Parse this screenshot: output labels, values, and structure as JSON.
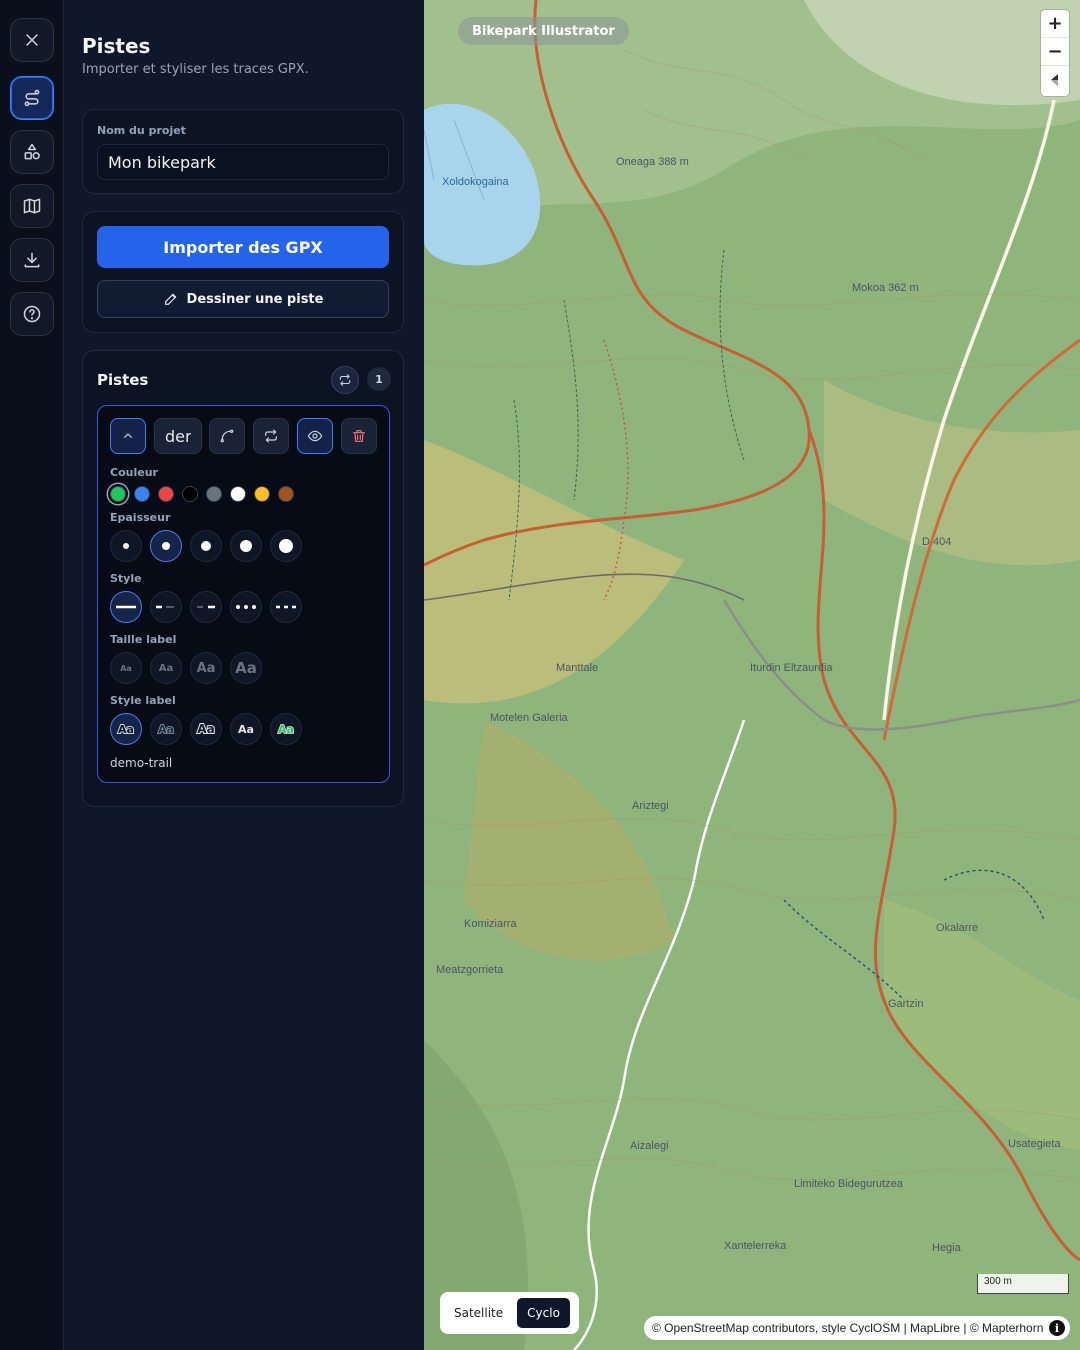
{
  "panel": {
    "title": "Pistes",
    "subtitle": "Importer et styliser les traces GPX."
  },
  "project": {
    "label": "Nom du projet",
    "value": "Mon bikepark"
  },
  "actions": {
    "import_label": "Importer des GPX",
    "draw_label": "Dessiner une piste"
  },
  "pistes": {
    "title": "Pistes",
    "count": "1",
    "track": {
      "name_value": "der",
      "name": "demo-trail",
      "color_label": "Couleur",
      "colors": [
        "#22c55e",
        "#3b82f6",
        "#ef4444",
        "#000000",
        "#6b7280",
        "#ffffff",
        "#fbbf24",
        "#a0521f"
      ],
      "selected_color": "#22c55e",
      "thickness_label": "Epaisseur",
      "thickness_selected": 2,
      "style_label": "Style",
      "style_selected": "solid",
      "label_size_label": "Taille label",
      "label_size_options": [
        "Aa",
        "Aa",
        "Aa",
        "Aa"
      ],
      "label_style_label": "Style label",
      "label_style_options": [
        "Aa",
        "Aa",
        "Aa",
        "Aa",
        "Aa"
      ]
    }
  },
  "map": {
    "app_badge": "Bikepark Illustrator",
    "zoom_in": "+",
    "zoom_out": "−",
    "layers": [
      "Satellite",
      "Cyclo"
    ],
    "active_layer": "Cyclo",
    "scale": "300 m",
    "attribution": "© OpenStreetMap contributors, style CyclOSM | MapLibre | © Mapterhorn",
    "place_names": [
      "Oneaga 388 m",
      "Mokoa 362 m",
      "Xoldokogaina",
      "Manttale",
      "Motelen Galeria",
      "Iturdin Eltzaurdia",
      "Ariztegi",
      "Komiziarra",
      "Meatzgorrieta",
      "Okalarre",
      "Gartzin",
      "Aizalegi",
      "Limiteko Bidegurutzea",
      "Usategieta",
      "Xantelerreka",
      "Hegia",
      "D 404"
    ]
  }
}
